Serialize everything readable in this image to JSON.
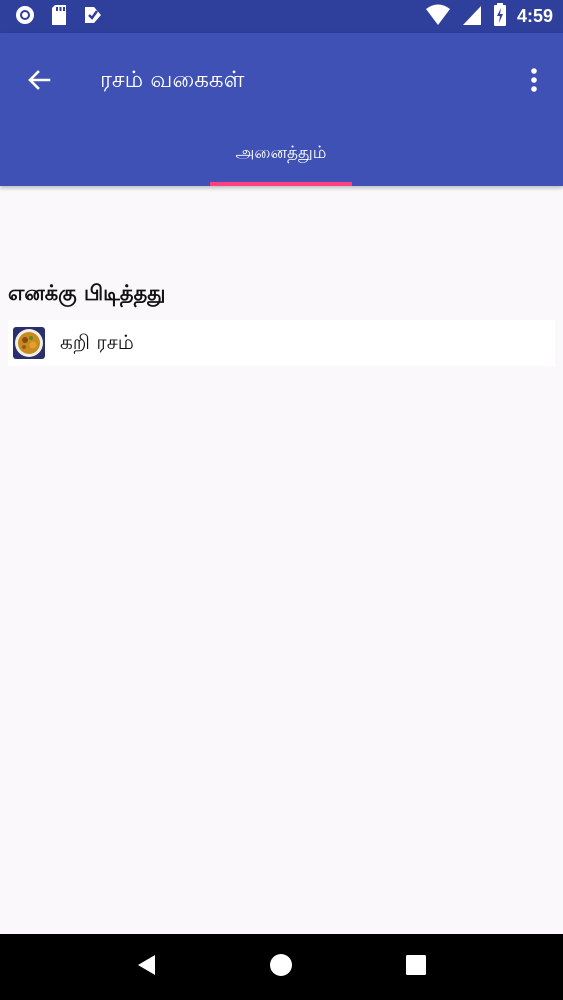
{
  "status_bar": {
    "time": "4:59",
    "icons": [
      "sync-icon",
      "sd-card-icon",
      "task-check-icon",
      "wifi-icon",
      "signal-icon",
      "battery-charging-icon"
    ]
  },
  "app_bar": {
    "title": "ரசம் வகைகள்",
    "back_icon": "arrow-back-icon",
    "overflow_icon": "more-vert-icon"
  },
  "tabs": [
    {
      "label": "அனைத்தும்",
      "selected": true
    }
  ],
  "colors": {
    "status_bar": "#2f3f9c",
    "app_bar": "#3f51b5",
    "tab_indicator": "#ff4081",
    "background": "#faf8fa"
  },
  "section": {
    "title": "எனக்கு பிடித்தது",
    "items": [
      {
        "label": "கறி ரசம்",
        "thumbnail": "dish-thumbnail"
      }
    ]
  },
  "nav_bar": {
    "icons": [
      "nav-back-icon",
      "nav-home-icon",
      "nav-recents-icon"
    ]
  }
}
